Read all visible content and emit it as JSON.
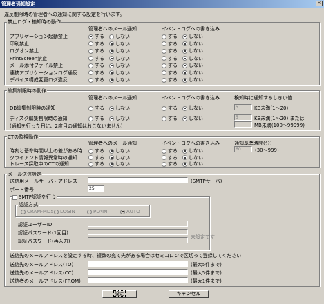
{
  "window": {
    "title": "管理者通知設定",
    "close": "×"
  },
  "intro": "違反制限時の管理者への通知に関する設定を行います。",
  "sec1": {
    "title": "禁止ログ・検知時の動作",
    "col_mail": "管理者へのメール通知",
    "col_log": "イベントログへの書き込み",
    "rows": [
      {
        "label": "アプリケーション起動禁止",
        "mail": "on",
        "log": "off"
      },
      {
        "label": "印刷禁止",
        "mail": "off",
        "log": "off"
      },
      {
        "label": "ログオン禁止",
        "mail": "off",
        "log": "off"
      },
      {
        "label": "PrintScreen禁止",
        "mail": "off",
        "log": "off"
      },
      {
        "label": "メール添付ファイル禁止",
        "mail": "off",
        "log": "off"
      },
      {
        "label": "連携アプリケーションログ通反",
        "mail": "off",
        "log": "off"
      },
      {
        "label": "デバイス構成変更ログ違反",
        "mail": "off",
        "log": "off"
      }
    ]
  },
  "radio": {
    "yes": "する",
    "no": "しない"
  },
  "sec2": {
    "title": "編集制限時の動作",
    "col_mail": "管理者へのメール通知",
    "col_log": "イベントログへの書き込み",
    "col_thr": "検知時に通知するしきい値",
    "rows": [
      {
        "label": "DB編集制限時の通知",
        "mail": "off",
        "log": "off",
        "value": "5",
        "unit": "KB未満(1〜20)"
      },
      {
        "label": "ディスク編集制限時の通知",
        "mail": "off",
        "log": "off",
        "value": "5",
        "unit": "KB未満(1〜20) または"
      }
    ],
    "mb_value": "",
    "mb_unit": "MB未満(100〜99999)",
    "note": "(通知を行った日に、2度目の通知はおこないません)"
  },
  "sec3": {
    "title": "CTの監視動作",
    "col_mail": "管理者へのメール通知",
    "col_log": "イベントログへの書き込み",
    "col_thr": "通知基準時間(分)",
    "rows": [
      {
        "label": "時刻と基準時間以上の差がある時",
        "mail": "off",
        "log": "off"
      },
      {
        "label": "クライアント情報異常時の通知",
        "mail": "off",
        "log": "off"
      },
      {
        "label": "トレース採取中のCTの通知",
        "mail": "off",
        "log": "off"
      }
    ],
    "thr_value": "60",
    "thr_unit": "(30〜999)"
  },
  "mail": {
    "title": "メール送信設定",
    "server_label": "送信用メールサーバ・アドレス",
    "server_value": "",
    "server_note": "(SMTPサーバ)",
    "port_label": "ポート番号",
    "port_value": "25",
    "smtp_auth_label": "SMTP認証を行う",
    "auth_method_title": "認証方式",
    "auth_methods": [
      "CRAM-MD5",
      "LOGIN",
      "PLAIN",
      "AUTO"
    ],
    "user_label": "認証ユーザーID",
    "pass_label": "認証パスワード(1回目)",
    "pass2_label": "認証パスワード(再入力)",
    "unset": "未設定です",
    "dest_note": "送信先のメールアドレスを設定する時、複数の宛て先がある場合はセミコロンで区切って登録してください",
    "to_label": "送信先のメールアドレス(TO)",
    "to_note": "(最大5件まで)",
    "cc_label": "送信先のメールアドレス(CC)",
    "cc_note": "(最大5件まで)",
    "from_label": "送信者のメールアドレス(FROM)",
    "from_note": "(最大1件まで)"
  },
  "buttons": {
    "ok": "設定",
    "cancel": "キャンセル"
  }
}
